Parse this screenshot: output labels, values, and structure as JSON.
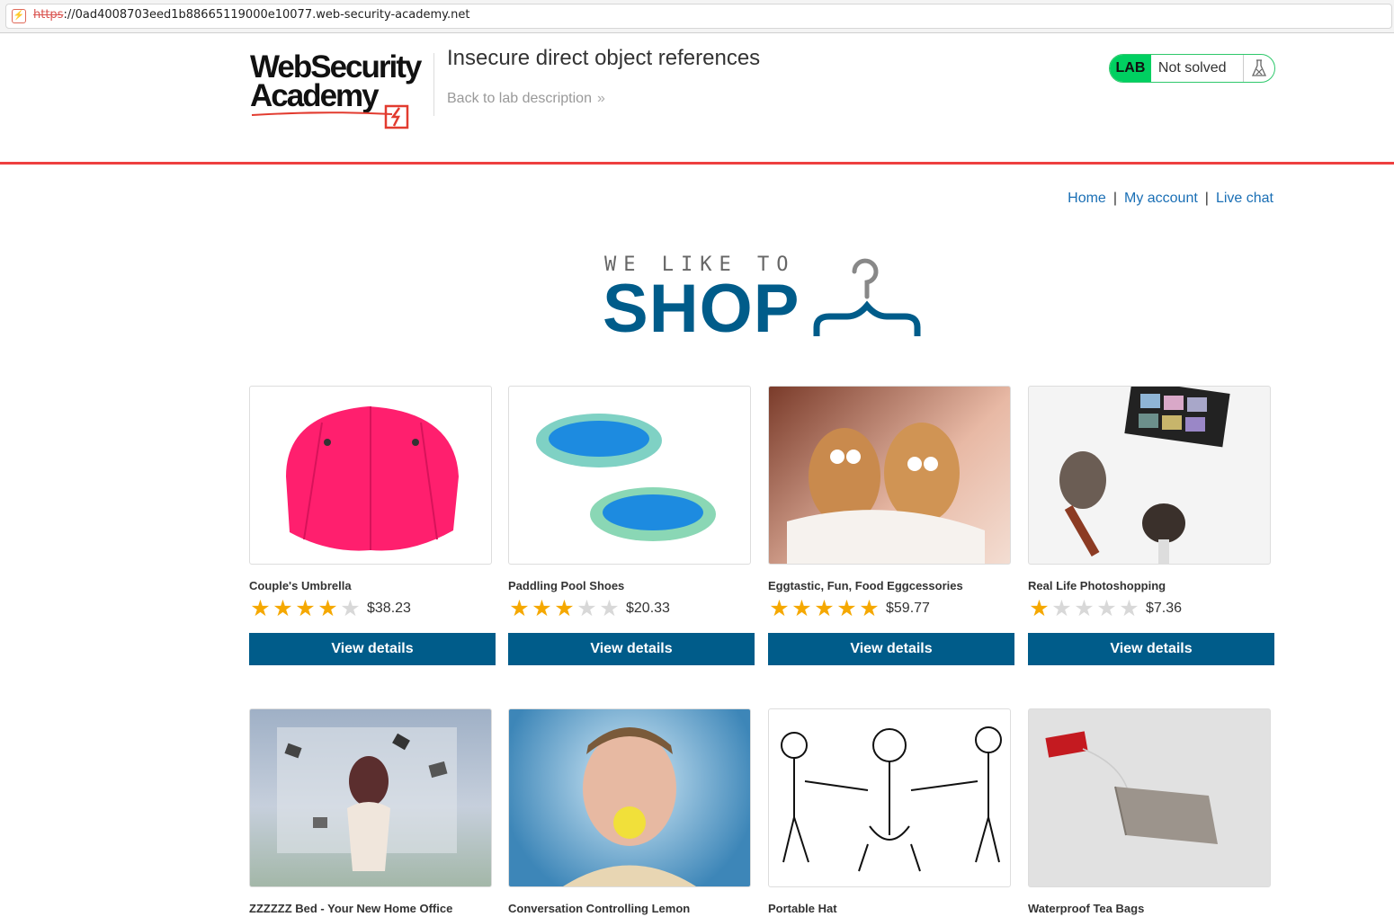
{
  "browser": {
    "url_scheme": "https",
    "url_rest": "://0ad4008703eed1b88665119000e10077.web-security-academy.net"
  },
  "header": {
    "logo_line1": "WebSecurity",
    "logo_line2": "Academy",
    "lab_title": "Insecure direct object references",
    "back_link": "Back to lab description",
    "status_lab": "LAB",
    "status_text": "Not solved"
  },
  "nav": {
    "home": "Home",
    "separator": "|",
    "my_account": "My account",
    "live_chat": "Live chat"
  },
  "banner": {
    "tagline": "WE LIKE TO",
    "shop": "SHOP"
  },
  "colors": {
    "accent": "#005c8a",
    "lab_green": "#00d061",
    "header_rule": "#ee3f3f",
    "star": "#f5a800",
    "link": "#1a6fb5"
  },
  "products": [
    {
      "name": "Couple's Umbrella",
      "rating": 4,
      "price": "$38.23",
      "button": "View details"
    },
    {
      "name": "Paddling Pool Shoes",
      "rating": 3,
      "price": "$20.33",
      "button": "View details"
    },
    {
      "name": "Eggtastic, Fun, Food Eggcessories",
      "rating": 5,
      "price": "$59.77",
      "button": "View details"
    },
    {
      "name": "Real Life Photoshopping",
      "rating": 1,
      "price": "$7.36",
      "button": "View details"
    },
    {
      "name": "ZZZZZZ Bed - Your New Home Office",
      "rating": null,
      "price": "",
      "button": ""
    },
    {
      "name": "Conversation Controlling Lemon",
      "rating": null,
      "price": "",
      "button": ""
    },
    {
      "name": "Portable Hat",
      "rating": null,
      "price": "",
      "button": ""
    },
    {
      "name": "Waterproof Tea Bags",
      "rating": null,
      "price": "",
      "button": ""
    }
  ]
}
